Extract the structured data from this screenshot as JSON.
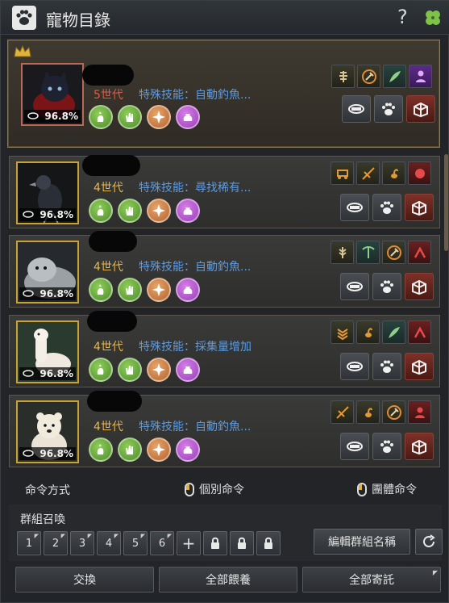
{
  "window": {
    "title": "寵物目錄",
    "help_label": "?"
  },
  "pets": [
    {
      "generation": "5世代",
      "gen_color": "#d95d4a",
      "special_skill": "特殊技能：自動釣魚...",
      "hunger": "96.8%",
      "animal": "black-cat",
      "main": true,
      "skills": [
        "horse-carriage-icon",
        "circle-axe-icon",
        "green-wing-icon",
        "purple-person-icon"
      ]
    },
    {
      "generation": "4世代",
      "gen_color": "#e6b64b",
      "special_skill": "特殊技能：尋找稀有...",
      "hunger": "96.8%",
      "animal": "crow",
      "skills": [
        "carriage-icon",
        "crossbow-icon",
        "scorpion-icon",
        "red-fist-icon"
      ]
    },
    {
      "generation": "4世代",
      "gen_color": "#e6b64b",
      "special_skill": "特殊技能：自動釣魚...",
      "hunger": "96.8%",
      "animal": "seal",
      "skills": [
        "wheat-person-icon",
        "pickaxe-icon",
        "circle-axe-icon",
        "red-person-icon"
      ]
    },
    {
      "generation": "4世代",
      "gen_color": "#e6b64b",
      "special_skill": "特殊技能：採集量增加",
      "hunger": "96.8%",
      "animal": "alpaca",
      "skills": [
        "wheat-icon",
        "scorpion-icon",
        "green-wing-icon",
        "red-person-icon"
      ]
    },
    {
      "generation": "4世代",
      "gen_color": "#e6b64b",
      "special_skill": "特殊技能：自動釣魚...",
      "hunger": "96.8%",
      "animal": "polar-bear",
      "skills": [
        "crossbow-icon",
        "scorpion-icon",
        "circle-axe-icon",
        "red-person-icon"
      ]
    }
  ],
  "command": {
    "title": "命令方式",
    "individual": "個別命令",
    "group": "團體命令"
  },
  "group_summon": {
    "title": "群組召喚",
    "slots": [
      "1",
      "2",
      "3",
      "4",
      "5",
      "6",
      "+"
    ],
    "locked_slots": 3,
    "edit_label": "編輯群組名稱"
  },
  "buttons": {
    "exchange": "交換",
    "feed_all": "全部餵養",
    "consign_all": "全部寄託"
  }
}
